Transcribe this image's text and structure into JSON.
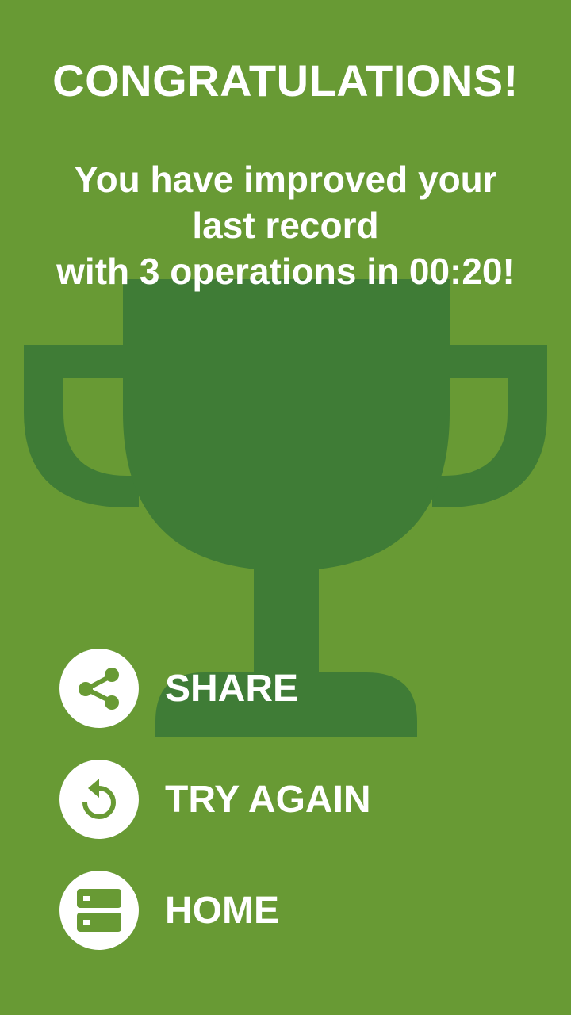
{
  "colors": {
    "background": "#689a34",
    "trophy": "#3f7c36",
    "text": "#ffffff",
    "icon": "#689a34"
  },
  "header": {
    "title": "CONGRATULATIONS!"
  },
  "message": {
    "line1": "You have improved your",
    "line2": "last record",
    "line3": "with 3 operations in 00:20!"
  },
  "actions": {
    "share": {
      "label": "SHARE",
      "icon": "share-icon"
    },
    "try_again": {
      "label": "TRY AGAIN",
      "icon": "replay-icon"
    },
    "home": {
      "label": "HOME",
      "icon": "home-icon"
    }
  },
  "decoration": {
    "background_icon": "trophy-icon"
  }
}
